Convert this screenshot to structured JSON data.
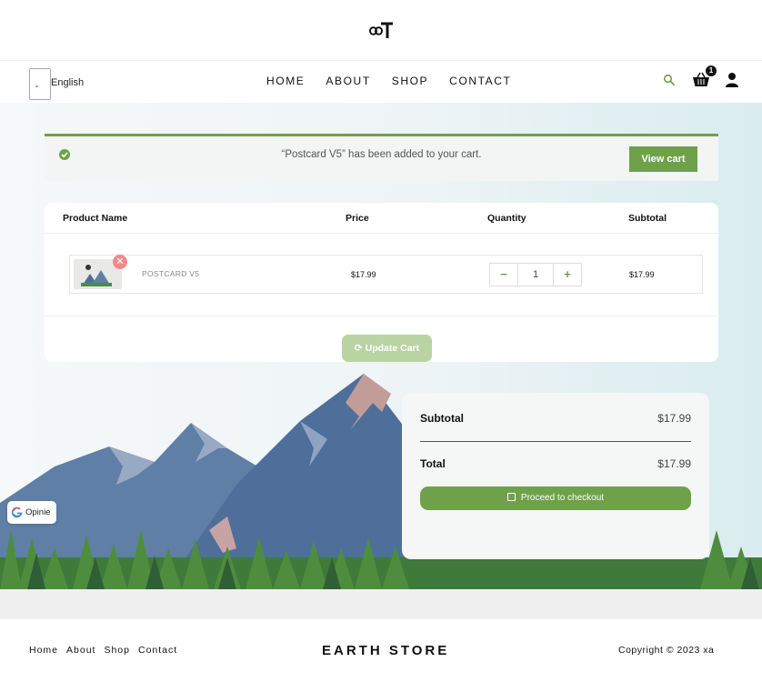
{
  "header": {
    "logo_alt": "logo"
  },
  "nav": {
    "language": "English",
    "menu": [
      "HOME",
      "ABOUT",
      "SHOP",
      "CONTACT"
    ],
    "cart_count": "1"
  },
  "notice": {
    "message": "“Postcard V5” has been added to your cart.",
    "view_cart_label": "View cart"
  },
  "cart": {
    "headers": {
      "name": "Product Name",
      "price": "Price",
      "quantity": "Quantity",
      "subtotal": "Subtotal"
    },
    "items": [
      {
        "name": "POSTCARD V5",
        "price": "$17.99",
        "quantity": "1",
        "subtotal": "$17.99"
      }
    ],
    "qty_minus": "−",
    "qty_plus": "+",
    "remove": "✕",
    "update_label": "Update Cart"
  },
  "totals": {
    "subtotal_label": "Subtotal",
    "subtotal_value": "$17.99",
    "total_label": "Total",
    "total_value": "$17.99",
    "checkout_label": "Proceed to checkout"
  },
  "google_badge": {
    "label": "Opinie"
  },
  "footer": {
    "links": [
      "Home",
      "About",
      "Shop",
      "Contact"
    ],
    "brand": "EARTH STORE",
    "copyright": "Copyright © 2023 xa"
  },
  "colors": {
    "accent": "#6fa14a",
    "accent_light": "#b9d3a3",
    "remove": "#f08a8a"
  }
}
